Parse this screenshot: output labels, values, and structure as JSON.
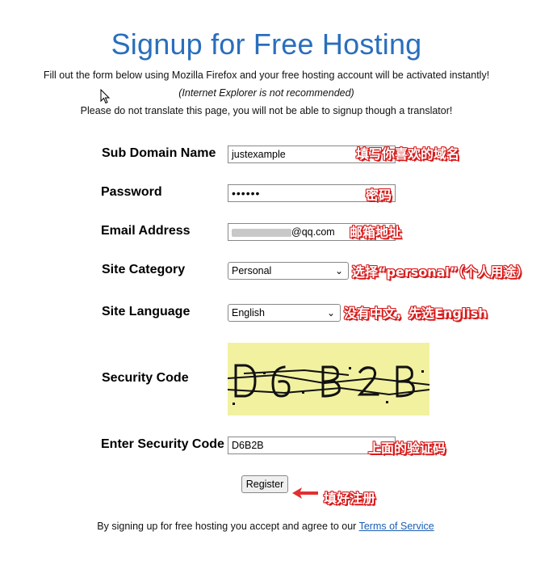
{
  "page": {
    "title": "Signup for Free Hosting",
    "intro1": "Fill out the form below using Mozilla Firefox and your free hosting account will be activated instantly!",
    "intro2": "(Internet Explorer is not recommended)",
    "intro3": "Please do not translate this page, you will not be able to signup though a translator!"
  },
  "form": {
    "subdomain": {
      "label": "Sub Domain Name",
      "value": "justexample",
      "note": "填写你喜欢的域名"
    },
    "password": {
      "label": "Password",
      "value": "••••••",
      "note": "密码"
    },
    "email": {
      "label": "Email Address",
      "value_suffix": "@qq.com",
      "note": "邮箱地址"
    },
    "category": {
      "label": "Site Category",
      "selected": "Personal",
      "note": "选择“personal”（个人用途）"
    },
    "language": {
      "label": "Site Language",
      "selected": "English",
      "note": "没有中文，先选English"
    },
    "security": {
      "label": "Security Code"
    },
    "enter_code": {
      "label": "Enter Security Code",
      "value": "D6B2B",
      "note": "上面的验证码"
    },
    "register": {
      "label": "Register",
      "note": "填好注册"
    }
  },
  "footer": {
    "text": "By signing up for free hosting you accept and agree to our ",
    "link": "Terms of Service"
  },
  "colors": {
    "title_blue": "#2a6ebd",
    "annotation_red": "#d71a1a",
    "captcha_bg": "#f2f1a0",
    "link_blue": "#1a5fb4"
  },
  "icons": {
    "cursor": "mouse-pointer-icon",
    "arrow": "red-arrow-icon",
    "select_chevron": "chevron-down-icon"
  }
}
